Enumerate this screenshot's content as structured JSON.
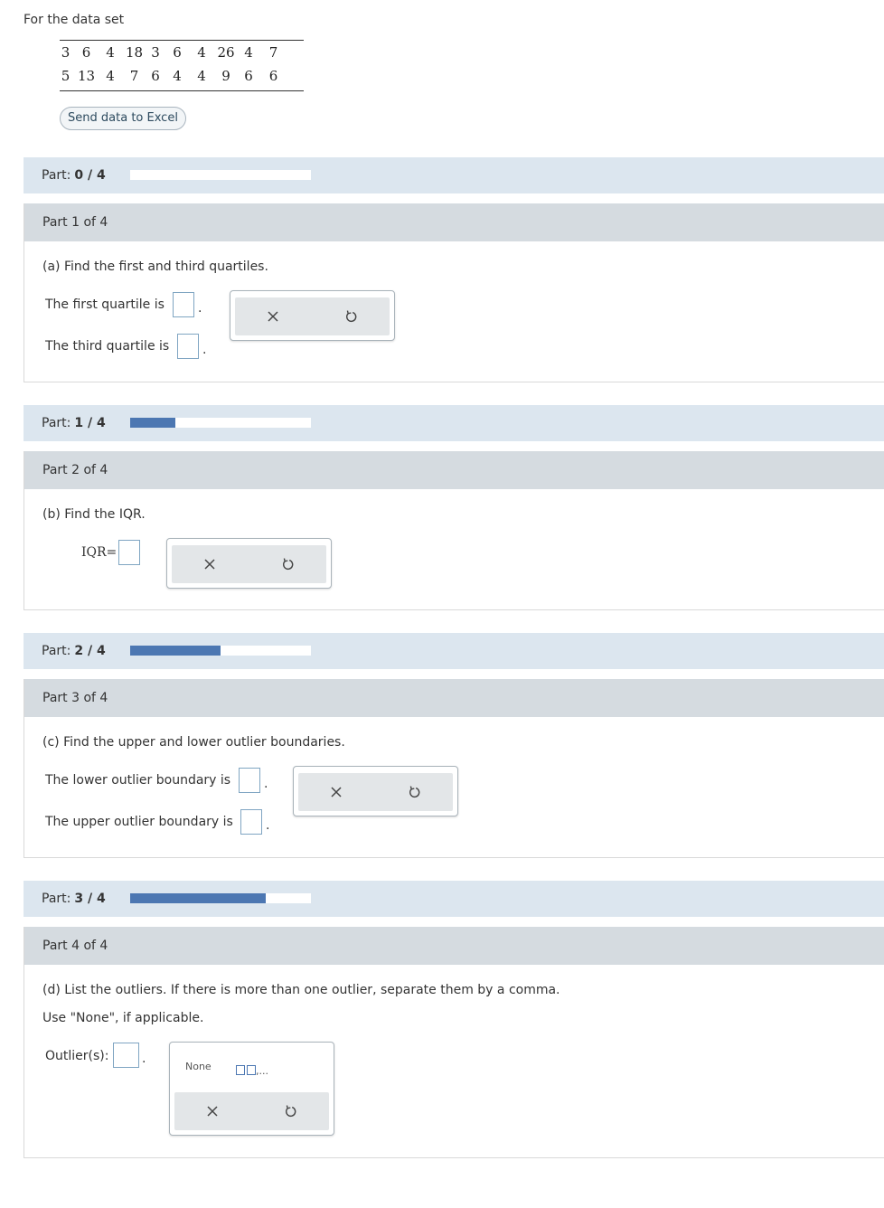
{
  "intro": "For the data set",
  "data_rows": [
    [
      "3",
      "6",
      "4",
      "18",
      "3",
      "6",
      "4",
      "26",
      "4",
      "7"
    ],
    [
      "5",
      "13",
      "4",
      "7",
      "6",
      "4",
      "4",
      "9",
      "6",
      "6"
    ]
  ],
  "excel_button": "Send data to Excel",
  "part_word": "Part:",
  "progress": [
    {
      "text": "0 / 4",
      "fraction": 0
    },
    {
      "text": "1 / 4",
      "fraction": 0.25
    },
    {
      "text": "2 / 4",
      "fraction": 0.5
    },
    {
      "text": "3 / 4",
      "fraction": 0.75
    }
  ],
  "parts": [
    {
      "heading": "Part 1 of 4",
      "question": "(a) Find the first and third quartiles.",
      "first_label": "The first quartile is",
      "third_label": "The third quartile is"
    },
    {
      "heading": "Part 2 of 4",
      "question": "(b) Find the IQR.",
      "iqr_label": "IQR="
    },
    {
      "heading": "Part 3 of 4",
      "question": "(c) Find the upper and lower outlier boundaries.",
      "lower_label": "The lower outlier boundary is",
      "upper_label": "The upper outlier boundary is"
    },
    {
      "heading": "Part 4 of 4",
      "question": "(d) List the outliers. If there is more than one outlier, separate them by a comma.",
      "hint": "Use \"None\", if applicable.",
      "outliers_label": "Outlier(s):",
      "none_option": "None",
      "list_option_suffix": ",..."
    }
  ],
  "icons": {
    "clear": "x-icon",
    "reset": "undo-icon"
  },
  "colors": {
    "accent": "#4c77b2",
    "part_bar": "#dce6ef",
    "section_head": "#d5dbe0",
    "input_border": "#7fa5c2"
  }
}
